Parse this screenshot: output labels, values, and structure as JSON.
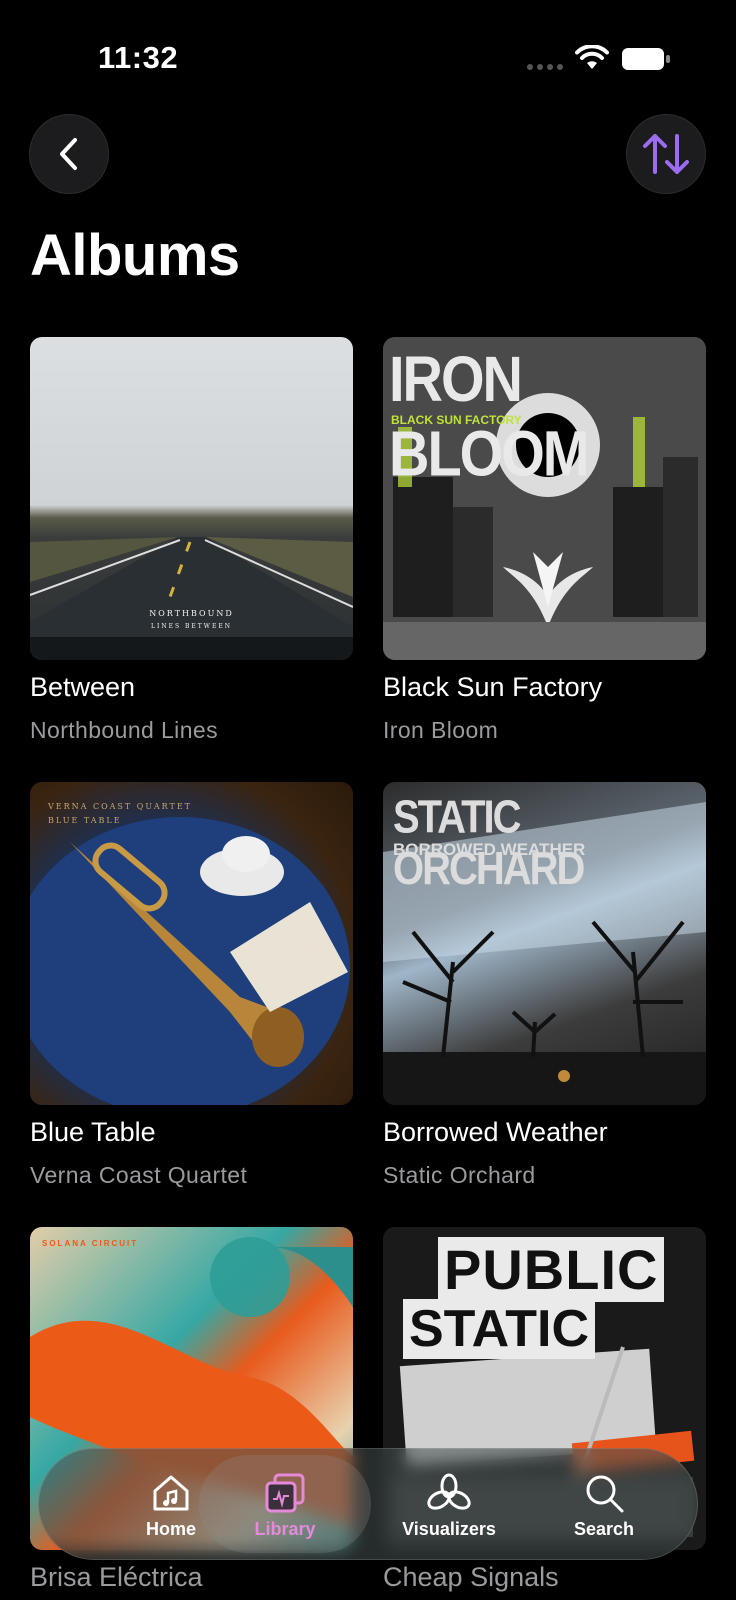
{
  "status_bar": {
    "time": "11:32"
  },
  "header": {
    "title": "Albums"
  },
  "albums": [
    {
      "title": "Between",
      "artist": "Northbound Lines",
      "cover_text": [
        "NORTHBOUND",
        "LINES BETWEEN"
      ]
    },
    {
      "title": "Black Sun Factory",
      "artist": "Iron Bloom",
      "cover_text": [
        "IRON BLOOM",
        "BLACK SUN FACTORY"
      ]
    },
    {
      "title": "Blue Table",
      "artist": "Verna Coast Quartet",
      "cover_text": [
        "VERNA COAST QUARTET",
        "BLUE TABLE"
      ]
    },
    {
      "title": "Borrowed Weather",
      "artist": "Static Orchard",
      "cover_text": [
        "STATIC ORCHARD",
        "BORROWED WEATHER"
      ]
    },
    {
      "title": "Brisa Eléctrica",
      "artist": "",
      "cover_text": [
        "SOLANA CIRCUIT"
      ]
    },
    {
      "title": "Cheap Signals",
      "artist": "",
      "cover_text": [
        "PUBLIC",
        "STATIC"
      ]
    }
  ],
  "tab_bar": {
    "items": [
      {
        "label": "Home",
        "icon": "home-music-icon"
      },
      {
        "label": "Library",
        "icon": "library-icon",
        "selected": true
      },
      {
        "label": "Visualizers",
        "icon": "visualizers-icon"
      },
      {
        "label": "Search",
        "icon": "search-icon"
      }
    ]
  },
  "colors": {
    "accent": "#9b6cf0",
    "library_active": "#e58ad8",
    "background": "#000000"
  }
}
